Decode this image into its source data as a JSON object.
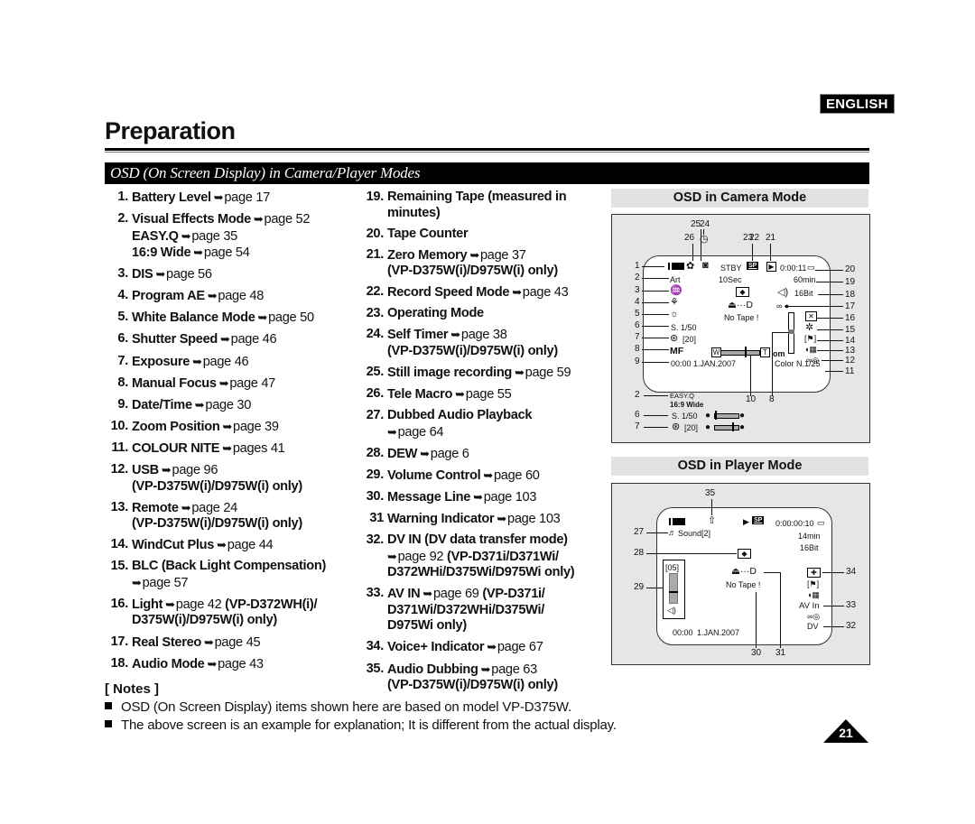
{
  "header": {
    "language_badge": "ENGLISH",
    "page_title": "Preparation",
    "section_title": "OSD (On Screen Display) in Camera/Player Modes"
  },
  "items": [
    {
      "num": "1.",
      "lines": [
        {
          "bold": "Battery Level",
          "ref": "page 17"
        }
      ]
    },
    {
      "num": "2.",
      "lines": [
        {
          "bold": "Visual Effects Mode",
          "ref": "page 52"
        },
        {
          "bold": "EASY.Q",
          "ref": "page 35"
        },
        {
          "bold": "16:9 Wide",
          "ref": "page 54"
        }
      ]
    },
    {
      "num": "3.",
      "lines": [
        {
          "bold": "DIS",
          "ref": "page 56"
        }
      ]
    },
    {
      "num": "4.",
      "lines": [
        {
          "bold": "Program AE",
          "ref": "page 48"
        }
      ]
    },
    {
      "num": "5.",
      "lines": [
        {
          "bold": "White Balance Mode",
          "ref": "page 50"
        }
      ]
    },
    {
      "num": "6.",
      "lines": [
        {
          "bold": "Shutter Speed",
          "ref": "page 46"
        }
      ]
    },
    {
      "num": "7.",
      "lines": [
        {
          "bold": "Exposure",
          "ref": "page 46"
        }
      ]
    },
    {
      "num": "8.",
      "lines": [
        {
          "bold": "Manual Focus",
          "ref": "page 47"
        }
      ]
    },
    {
      "num": "9.",
      "lines": [
        {
          "bold": "Date/Time",
          "ref": "page 30"
        }
      ]
    },
    {
      "num": "10.",
      "lines": [
        {
          "bold": "Zoom Position",
          "ref": "page 39"
        }
      ]
    },
    {
      "num": "11.",
      "lines": [
        {
          "bold": "COLOUR NITE",
          "ref": "pages 41"
        }
      ]
    },
    {
      "num": "12.",
      "lines": [
        {
          "bold": "USB",
          "ref": "page 96"
        },
        {
          "bold": "(VP-D375W(i)/D975W(i) only)"
        }
      ]
    },
    {
      "num": "13.",
      "lines": [
        {
          "bold": "Remote",
          "ref": "page 24"
        },
        {
          "bold": "(VP-D375W(i)/D975W(i) only)"
        }
      ]
    },
    {
      "num": "14.",
      "lines": [
        {
          "bold": "WindCut Plus",
          "ref": "page 44"
        }
      ]
    },
    {
      "num": "15.",
      "lines": [
        {
          "bold": "BLC (Back Light Compensation)"
        },
        {
          "bold": "",
          "ref": "page 57"
        }
      ]
    },
    {
      "num": "16.",
      "lines": [
        {
          "bold": "Light",
          "ref": "page 42",
          "suffix": " (VP-D372WH(i)/"
        },
        {
          "bold": "D375W(i)/D975W(i) only)"
        }
      ]
    },
    {
      "num": "17.",
      "lines": [
        {
          "bold": "Real Stereo",
          "ref": "page 45"
        }
      ]
    },
    {
      "num": "18.",
      "lines": [
        {
          "bold": "Audio Mode",
          "ref": "page 43"
        }
      ]
    },
    {
      "num": "19.",
      "lines": [
        {
          "bold": "Remaining Tape (measured in"
        },
        {
          "bold": "minutes)"
        }
      ]
    },
    {
      "num": "20.",
      "lines": [
        {
          "bold": "Tape Counter"
        }
      ]
    },
    {
      "num": "21.",
      "lines": [
        {
          "bold": "Zero Memory",
          "ref": "page 37"
        },
        {
          "bold": "(VP-D375W(i)/D975W(i) only)"
        }
      ]
    },
    {
      "num": "22.",
      "lines": [
        {
          "bold": "Record Speed Mode",
          "ref": "page 43"
        }
      ]
    },
    {
      "num": "23.",
      "lines": [
        {
          "bold": "Operating Mode"
        }
      ]
    },
    {
      "num": "24.",
      "lines": [
        {
          "bold": "Self Timer",
          "ref": "page 38"
        },
        {
          "bold": "(VP-D375W(i)/D975W(i) only)"
        }
      ]
    },
    {
      "num": "25.",
      "lines": [
        {
          "bold": "Still image recording",
          "ref": "page 59"
        }
      ]
    },
    {
      "num": "26.",
      "lines": [
        {
          "bold": "Tele Macro",
          "ref": "page 55"
        }
      ]
    },
    {
      "num": "27.",
      "lines": [
        {
          "bold": "Dubbed Audio Playback"
        },
        {
          "bold": "",
          "ref": "page 64"
        }
      ]
    },
    {
      "num": "28.",
      "lines": [
        {
          "bold": "DEW",
          "ref": "page 6"
        }
      ]
    },
    {
      "num": "29.",
      "lines": [
        {
          "bold": "Volume Control",
          "ref": "page 60"
        }
      ]
    },
    {
      "num": "30.",
      "lines": [
        {
          "bold": "Message Line",
          "ref": "page 103"
        }
      ]
    },
    {
      "num": "31",
      "lines": [
        {
          "bold": "Warning Indicator",
          "ref": "page 103"
        }
      ]
    },
    {
      "num": "32.",
      "lines": [
        {
          "bold": "DV IN (DV data transfer mode)"
        },
        {
          "bold": "",
          "ref": "page 92",
          "suffix": " (VP-D371i/D371Wi/"
        },
        {
          "bold": "D372WHi/D375Wi/D975Wi only)"
        }
      ]
    },
    {
      "num": "33.",
      "lines": [
        {
          "bold": "AV IN",
          "ref": "page 69",
          "suffix": " (VP-D371i/"
        },
        {
          "bold": "D371Wi/D372WHi/D375Wi/"
        },
        {
          "bold": "D975Wi only)"
        }
      ]
    },
    {
      "num": "34.",
      "lines": [
        {
          "bold": "Voice+ Indicator",
          "ref": "page 67"
        }
      ]
    },
    {
      "num": "35.",
      "lines": [
        {
          "bold": "Audio Dubbing",
          "ref": "page 63"
        },
        {
          "bold": "(VP-D375W(i)/D975W(i) only)"
        }
      ]
    }
  ],
  "notes": {
    "title": "[ Notes ]",
    "bullets": [
      "OSD (On Screen Display) items shown here are based on model VP-D375W.",
      "The above screen is an example for explanation; It is different from the actual display."
    ]
  },
  "page_number": "21",
  "camera_osd": {
    "heading": "OSD in Camera Mode",
    "callouts": [
      "1",
      "2",
      "3",
      "4",
      "5",
      "6",
      "7",
      "8",
      "9",
      "19",
      "20",
      "18",
      "17",
      "16",
      "15",
      "14",
      "13",
      "12",
      "11",
      "26",
      "25",
      "24",
      "23",
      "22",
      "21",
      "10",
      "8"
    ],
    "operating_mode": "STBY",
    "self_timer": "10Sec",
    "record_speed": "SP",
    "tape_counter": "0:00:11",
    "remaining_tape": "60min",
    "audio_mode": "16Bit",
    "visual_effect": "Art",
    "warning": "⏏···D",
    "message": "No Tape !",
    "shutter": "S. 1/50",
    "exposure": "[20]",
    "manual_focus": "MF",
    "time": "00:00",
    "date": "1.JAN.2007",
    "colour_nite": "Color N.1/25",
    "zoom_w": "W",
    "zoom_t": "T",
    "focus_far": "∞",
    "focus_near": "om",
    "easy_q": "EASY.Q",
    "wide": "16:9 Wide",
    "lower_callouts": [
      "2",
      "6",
      "7"
    ]
  },
  "player_osd": {
    "heading": "OSD in Player Mode",
    "record_speed": "SP",
    "tape_counter": "0:00:00:10",
    "remaining_tape": "14min",
    "audio_mode": "16Bit",
    "dubbed_audio": "Sound[2]",
    "volume": "[05]",
    "warning": "⏏···D",
    "message": "No Tape !",
    "av_in": "AV In",
    "time": "00:00",
    "date": "1.JAN.2007",
    "callouts": [
      "35",
      "27",
      "28",
      "29",
      "34",
      "33",
      "32",
      "30",
      "31"
    ]
  }
}
